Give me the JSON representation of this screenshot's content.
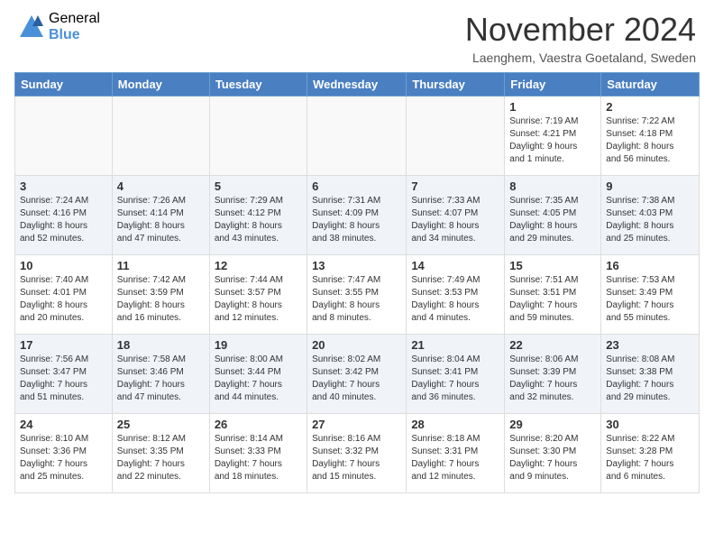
{
  "logo": {
    "general": "General",
    "blue": "Blue"
  },
  "title": "November 2024",
  "location": "Laenghem, Vaestra Goetaland, Sweden",
  "headers": [
    "Sunday",
    "Monday",
    "Tuesday",
    "Wednesday",
    "Thursday",
    "Friday",
    "Saturday"
  ],
  "rows": [
    [
      {
        "num": "",
        "info": ""
      },
      {
        "num": "",
        "info": ""
      },
      {
        "num": "",
        "info": ""
      },
      {
        "num": "",
        "info": ""
      },
      {
        "num": "",
        "info": ""
      },
      {
        "num": "1",
        "info": "Sunrise: 7:19 AM\nSunset: 4:21 PM\nDaylight: 9 hours\nand 1 minute."
      },
      {
        "num": "2",
        "info": "Sunrise: 7:22 AM\nSunset: 4:18 PM\nDaylight: 8 hours\nand 56 minutes."
      }
    ],
    [
      {
        "num": "3",
        "info": "Sunrise: 7:24 AM\nSunset: 4:16 PM\nDaylight: 8 hours\nand 52 minutes."
      },
      {
        "num": "4",
        "info": "Sunrise: 7:26 AM\nSunset: 4:14 PM\nDaylight: 8 hours\nand 47 minutes."
      },
      {
        "num": "5",
        "info": "Sunrise: 7:29 AM\nSunset: 4:12 PM\nDaylight: 8 hours\nand 43 minutes."
      },
      {
        "num": "6",
        "info": "Sunrise: 7:31 AM\nSunset: 4:09 PM\nDaylight: 8 hours\nand 38 minutes."
      },
      {
        "num": "7",
        "info": "Sunrise: 7:33 AM\nSunset: 4:07 PM\nDaylight: 8 hours\nand 34 minutes."
      },
      {
        "num": "8",
        "info": "Sunrise: 7:35 AM\nSunset: 4:05 PM\nDaylight: 8 hours\nand 29 minutes."
      },
      {
        "num": "9",
        "info": "Sunrise: 7:38 AM\nSunset: 4:03 PM\nDaylight: 8 hours\nand 25 minutes."
      }
    ],
    [
      {
        "num": "10",
        "info": "Sunrise: 7:40 AM\nSunset: 4:01 PM\nDaylight: 8 hours\nand 20 minutes."
      },
      {
        "num": "11",
        "info": "Sunrise: 7:42 AM\nSunset: 3:59 PM\nDaylight: 8 hours\nand 16 minutes."
      },
      {
        "num": "12",
        "info": "Sunrise: 7:44 AM\nSunset: 3:57 PM\nDaylight: 8 hours\nand 12 minutes."
      },
      {
        "num": "13",
        "info": "Sunrise: 7:47 AM\nSunset: 3:55 PM\nDaylight: 8 hours\nand 8 minutes."
      },
      {
        "num": "14",
        "info": "Sunrise: 7:49 AM\nSunset: 3:53 PM\nDaylight: 8 hours\nand 4 minutes."
      },
      {
        "num": "15",
        "info": "Sunrise: 7:51 AM\nSunset: 3:51 PM\nDaylight: 7 hours\nand 59 minutes."
      },
      {
        "num": "16",
        "info": "Sunrise: 7:53 AM\nSunset: 3:49 PM\nDaylight: 7 hours\nand 55 minutes."
      }
    ],
    [
      {
        "num": "17",
        "info": "Sunrise: 7:56 AM\nSunset: 3:47 PM\nDaylight: 7 hours\nand 51 minutes."
      },
      {
        "num": "18",
        "info": "Sunrise: 7:58 AM\nSunset: 3:46 PM\nDaylight: 7 hours\nand 47 minutes."
      },
      {
        "num": "19",
        "info": "Sunrise: 8:00 AM\nSunset: 3:44 PM\nDaylight: 7 hours\nand 44 minutes."
      },
      {
        "num": "20",
        "info": "Sunrise: 8:02 AM\nSunset: 3:42 PM\nDaylight: 7 hours\nand 40 minutes."
      },
      {
        "num": "21",
        "info": "Sunrise: 8:04 AM\nSunset: 3:41 PM\nDaylight: 7 hours\nand 36 minutes."
      },
      {
        "num": "22",
        "info": "Sunrise: 8:06 AM\nSunset: 3:39 PM\nDaylight: 7 hours\nand 32 minutes."
      },
      {
        "num": "23",
        "info": "Sunrise: 8:08 AM\nSunset: 3:38 PM\nDaylight: 7 hours\nand 29 minutes."
      }
    ],
    [
      {
        "num": "24",
        "info": "Sunrise: 8:10 AM\nSunset: 3:36 PM\nDaylight: 7 hours\nand 25 minutes."
      },
      {
        "num": "25",
        "info": "Sunrise: 8:12 AM\nSunset: 3:35 PM\nDaylight: 7 hours\nand 22 minutes."
      },
      {
        "num": "26",
        "info": "Sunrise: 8:14 AM\nSunset: 3:33 PM\nDaylight: 7 hours\nand 18 minutes."
      },
      {
        "num": "27",
        "info": "Sunrise: 8:16 AM\nSunset: 3:32 PM\nDaylight: 7 hours\nand 15 minutes."
      },
      {
        "num": "28",
        "info": "Sunrise: 8:18 AM\nSunset: 3:31 PM\nDaylight: 7 hours\nand 12 minutes."
      },
      {
        "num": "29",
        "info": "Sunrise: 8:20 AM\nSunset: 3:30 PM\nDaylight: 7 hours\nand 9 minutes."
      },
      {
        "num": "30",
        "info": "Sunrise: 8:22 AM\nSunset: 3:28 PM\nDaylight: 7 hours\nand 6 minutes."
      }
    ]
  ]
}
